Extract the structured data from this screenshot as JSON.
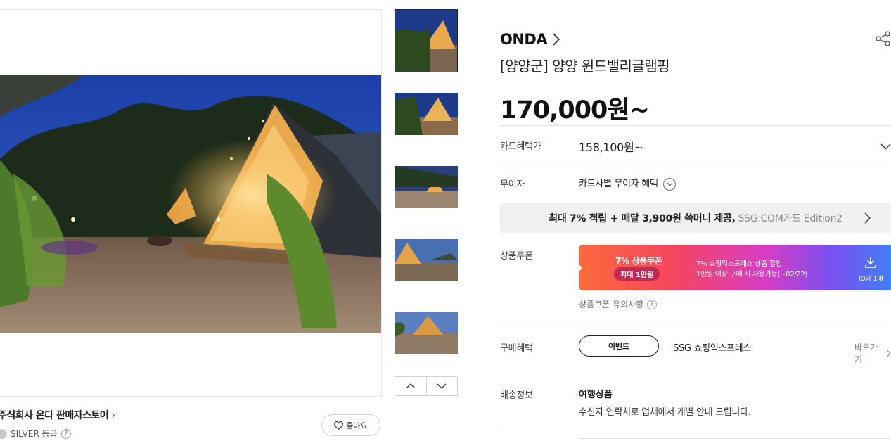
{
  "gallery": {
    "thumbnail_count": 5,
    "active_index": 0
  },
  "seller": {
    "name": "주식회사 온다 판매자스토어",
    "grade": "SILVER 등급",
    "like_label": "좋아요"
  },
  "product": {
    "brand": "ONDA",
    "title": "[양양군] 양양 윈드밸리글램핑",
    "price": "170,000원~"
  },
  "card_benefit": {
    "label": "카드혜택가",
    "value": "158,100원~"
  },
  "installment": {
    "label": "무이자",
    "value": "카드사별 무이자 혜택"
  },
  "promo": {
    "main": "최대 7% 적립 + 매달 3,900원 쓱머니 제공,",
    "sub": "SSG.COM카드 Edition2"
  },
  "coupon": {
    "label": "상품쿠폰",
    "title": "7% 상품쿠폰",
    "max": "최대 1만원",
    "desc_line1": "7% 쇼핑익스프레스 상품 할인",
    "desc_line2": "1만원 이상 구매 시 사용가능(~02/22)",
    "limit": "ID당 1매",
    "note": "상품쿠폰 유의사항",
    "colors": [
      "#fb6a3c",
      "#f5455f",
      "#d73dc6",
      "#7b4ff0",
      "#3f7ff5"
    ]
  },
  "purchase_benefit": {
    "label": "구매혜택",
    "event_label": "이벤트",
    "express": "SSG 쇼핑익스프레스",
    "goto": "바로가기"
  },
  "shipping": {
    "label": "배송정보",
    "title": "여행상품",
    "desc": "수신자 연락처로 업체에서 개별 안내 드립니다."
  },
  "icons": [
    "share-icon",
    "chevron-right-icon",
    "chevron-down-icon",
    "heart-icon",
    "download-icon",
    "help-icon",
    "chevron-up-icon"
  ]
}
